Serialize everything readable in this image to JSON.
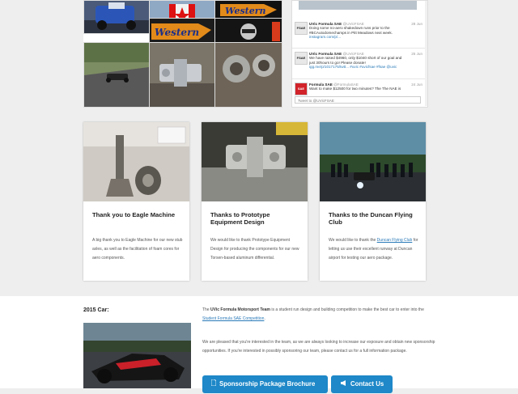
{
  "colors": {
    "accent": "#1e88c8",
    "link": "#2a7ab8",
    "page_bg": "#eeeeee"
  },
  "instagram": {
    "tiles": [
      {
        "name": "ig-tile-racer-blue"
      },
      {
        "name": "ig-tile-western-sticker",
        "text": "Western"
      },
      {
        "name": "ig-tile-western-car",
        "text": "Western"
      },
      {
        "name": "ig-tile-western-driver",
        "text": "Western"
      },
      {
        "name": "ig-tile-car-on-track"
      },
      {
        "name": "ig-tile-machined-part"
      },
      {
        "name": "ig-tile-machined-ring"
      }
    ]
  },
  "twitter": {
    "tweets": [
      {
        "name": "UVic Formula SAE",
        "handle": "@UVicFSAE",
        "date": "28 Jun",
        "lines": [
          "Doing some no-aero shakedown runs prior to the",
          "#BCAutodomechamps in Pitt Meadows next week.",
          "instagram.com/p/..."
        ]
      },
      {
        "name": "UVic Formula SAE",
        "handle": "@UVicFSAE",
        "date": "25 Jun",
        "lines": [
          "We have raised $4960, only $1040 short of our goal and",
          "just 30hours to go! Please donate!",
          "igg.me/p/1017175/twtt... #uvic #uvicfsae #fsae @uvic"
        ]
      },
      {
        "name": "Formula SAE",
        "handle": "@FormulaSAE",
        "date": "24 Jun",
        "lines": [
          "Want to make $12500 for two minutes? The The NAE is"
        ]
      }
    ],
    "tweet_to": "Tweet to @UVicFSAE"
  },
  "cards": [
    {
      "title": "Thank you to Eagle Machine",
      "text": "A big thank you to Eagle Machine for our new stub axles, as well as the facilitation of foam cores for aero components."
    },
    {
      "title": "Thanks to Prototype Equipment Design",
      "text": "We would like to thank Prototype Equipment Design for producing the components for our new Torsen-based aluminum differential."
    },
    {
      "title": "Thanks to the Duncan Flying Club",
      "text_before": "We would like to thank the ",
      "link": "Duncan Flying Club",
      "text_after": " for letting us use their excellent runway at Duncan airport for testing our aero package."
    }
  ],
  "bottom": {
    "car_title": "2015 Car:",
    "para1_bold": "UVic Formula Motorsport Team",
    "para1_text": " is a student run design and building competition to make the best car to enter into the ",
    "para1_link": "Student Formula SAE Competition",
    "para1_end": ".",
    "para1_prefix": "The ",
    "para2": "We are pleased that you're interested in the team, as we are always looking to increase our exposure and obtain new sponsorship opportunities. If you're interested in possibly sponsoring our team, please contact us for a full information package.",
    "btn_brochure": "Sponsorship Package Brochure",
    "btn_contact": "Contact Us"
  }
}
